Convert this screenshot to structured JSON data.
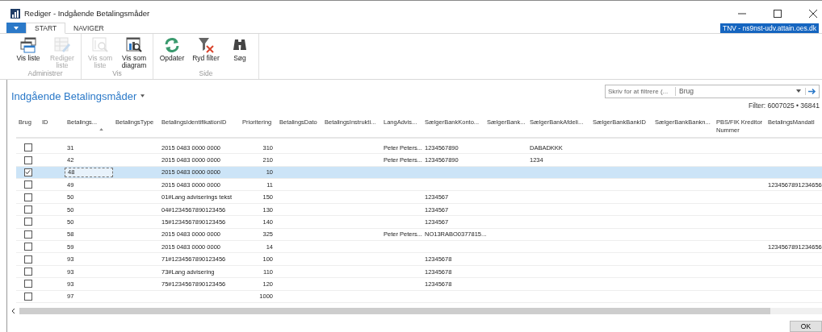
{
  "window": {
    "title": "Rediger - Indgående Betalingsmåder",
    "server": "TNV - ns9nst-udv.attain.oes.dk"
  },
  "tabs": [
    {
      "label": "START",
      "selected": true
    },
    {
      "label": "NAVIGER",
      "selected": false
    }
  ],
  "ribbon_groups": [
    {
      "label": "Administrer",
      "buttons": [
        {
          "kind": "list",
          "label": "Vis liste",
          "disabled": false
        },
        {
          "kind": "edit",
          "label": "Rediger liste",
          "disabled": true
        }
      ]
    },
    {
      "label": "Vis",
      "buttons": [
        {
          "kind": "viewlist",
          "label": "Vis som liste",
          "disabled": true
        },
        {
          "kind": "chart",
          "label": "Vis som diagram",
          "disabled": false
        }
      ]
    },
    {
      "label": "Side",
      "buttons": [
        {
          "kind": "refresh",
          "label": "Opdater",
          "disabled": false
        },
        {
          "kind": "clearfilter",
          "label": "Ryd filter",
          "disabled": false
        },
        {
          "kind": "find",
          "label": "Søg",
          "disabled": false
        }
      ]
    }
  ],
  "page_title": "Indgående Betalingsmåder",
  "filter": {
    "placeholder": "Skriv for at filtrere (...",
    "field": "Brug",
    "summary": "Filter: 6007025 • 36841"
  },
  "columns": [
    {
      "label": "Brug",
      "sorted": false
    },
    {
      "label": "ID",
      "sorted": false
    },
    {
      "label": "Betalings...",
      "sorted": true
    },
    {
      "label": "BetalingsType",
      "sorted": false
    },
    {
      "label": "BetalingsIdentifikationID",
      "sorted": false
    },
    {
      "label": "Prioritering",
      "sorted": false
    },
    {
      "label": "BetalingsDato",
      "sorted": false
    },
    {
      "label": "BetalingsInstrukti...",
      "sorted": false
    },
    {
      "label": "LangAdvis...",
      "sorted": false
    },
    {
      "label": "SælgerBankKonto...",
      "sorted": false
    },
    {
      "label": "SælgerBank...",
      "sorted": false
    },
    {
      "label": "SælgerBankAfdeli...",
      "sorted": false
    },
    {
      "label": "SælgerBankBankID",
      "sorted": false
    },
    {
      "label": "SælgerBankBankn...",
      "sorted": false
    },
    {
      "label": "PBS/FIK Kreditor Nummer",
      "sorted": false
    },
    {
      "label": "BetalingsMandatI",
      "sorted": false
    }
  ],
  "rows": [
    {
      "selected": false,
      "brug": false,
      "cells": [
        "",
        "31",
        "",
        "2015 0483 0000 0000",
        "310",
        "",
        "",
        "Peter Peters...",
        "1234567890",
        "",
        "DABADKKK",
        "",
        "",
        "",
        ""
      ]
    },
    {
      "selected": false,
      "brug": false,
      "cells": [
        "",
        "42",
        "",
        "2015 0483 0000 0000",
        "210",
        "",
        "",
        "Peter Peters...",
        "1234567890",
        "",
        "1234",
        "",
        "",
        "",
        ""
      ]
    },
    {
      "selected": true,
      "brug": true,
      "cells": [
        "",
        "48",
        "",
        "2015 0483 0000 0000",
        "10",
        "",
        "",
        "",
        "",
        "",
        "",
        "",
        "",
        "",
        ""
      ]
    },
    {
      "selected": false,
      "brug": false,
      "cells": [
        "",
        "49",
        "",
        "2015 0483 0000 0000",
        "11",
        "",
        "",
        "",
        "",
        "",
        "",
        "",
        "",
        "",
        "1234567891234656"
      ]
    },
    {
      "selected": false,
      "brug": false,
      "cells": [
        "",
        "50",
        "",
        "01#Lang adviserings tekst",
        "150",
        "",
        "",
        "",
        "1234567",
        "",
        "",
        "",
        "",
        "",
        ""
      ]
    },
    {
      "selected": false,
      "brug": false,
      "cells": [
        "",
        "50",
        "",
        "04#1234567890123456",
        "130",
        "",
        "",
        "",
        "1234567",
        "",
        "",
        "",
        "",
        "",
        ""
      ]
    },
    {
      "selected": false,
      "brug": false,
      "cells": [
        "",
        "50",
        "",
        "15#1234567890123456",
        "140",
        "",
        "",
        "",
        "1234567",
        "",
        "",
        "",
        "",
        "",
        ""
      ]
    },
    {
      "selected": false,
      "brug": false,
      "cells": [
        "",
        "58",
        "",
        "2015 0483 0000 0000",
        "325",
        "",
        "",
        "Peter Peters...",
        "NO13RABO0377815...",
        "",
        "",
        "",
        "",
        "",
        ""
      ]
    },
    {
      "selected": false,
      "brug": false,
      "cells": [
        "",
        "59",
        "",
        "2015 0483 0000 0000",
        "14",
        "",
        "",
        "",
        "",
        "",
        "",
        "",
        "",
        "",
        "1234567891234656"
      ]
    },
    {
      "selected": false,
      "brug": false,
      "cells": [
        "",
        "93",
        "",
        "71#1234567890123456",
        "100",
        "",
        "",
        "",
        "12345678",
        "",
        "",
        "",
        "",
        "",
        ""
      ]
    },
    {
      "selected": false,
      "brug": false,
      "cells": [
        "",
        "93",
        "",
        "73#Lang advisering",
        "110",
        "",
        "",
        "",
        "12345678",
        "",
        "",
        "",
        "",
        "",
        ""
      ]
    },
    {
      "selected": false,
      "brug": false,
      "cells": [
        "",
        "93",
        "",
        "75#1234567890123456",
        "120",
        "",
        "",
        "",
        "12345678",
        "",
        "",
        "",
        "",
        "",
        ""
      ]
    },
    {
      "selected": false,
      "brug": false,
      "cells": [
        "",
        "97",
        "",
        "",
        "1000",
        "",
        "",
        "",
        "",
        "",
        "",
        "",
        "",
        "",
        ""
      ]
    }
  ],
  "buttons": [
    "OK"
  ]
}
